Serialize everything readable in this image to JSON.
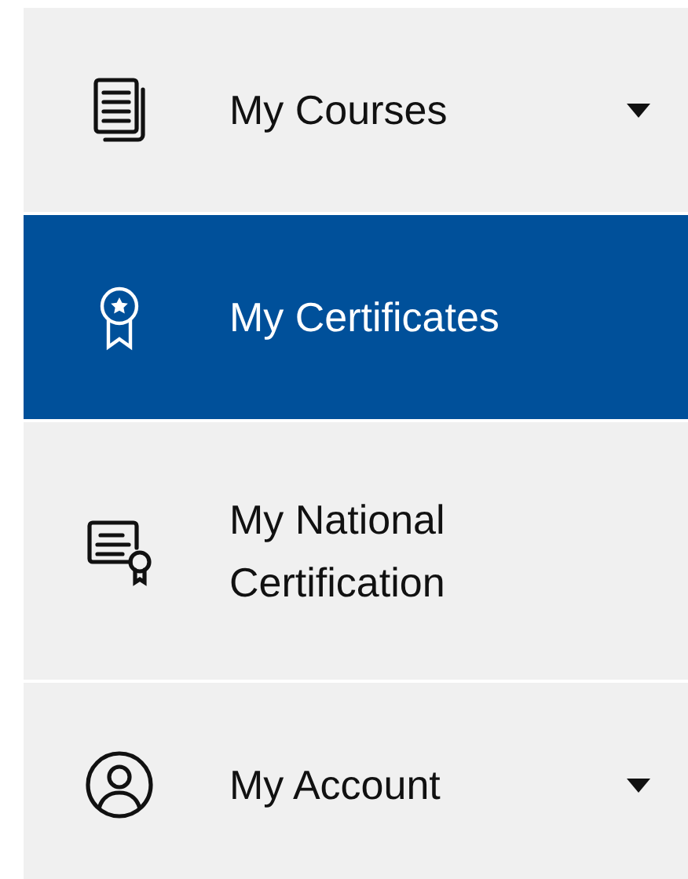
{
  "menu": [
    {
      "label": "My Courses",
      "selected": false,
      "has_submenu": true
    },
    {
      "label": "My Certificates",
      "selected": true,
      "has_submenu": false
    },
    {
      "label": "My National Certification",
      "selected": false,
      "has_submenu": false
    },
    {
      "label": "My Account",
      "selected": false,
      "has_submenu": true
    }
  ]
}
